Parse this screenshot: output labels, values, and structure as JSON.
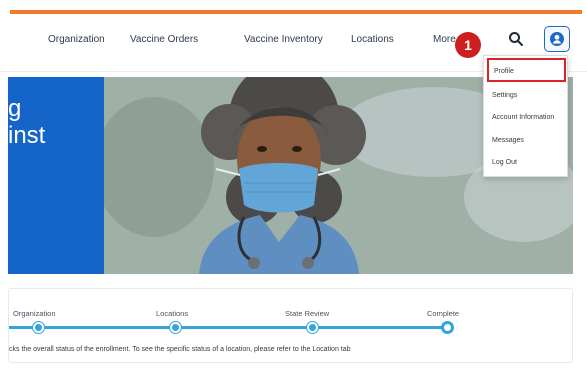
{
  "nav": {
    "items": [
      {
        "label": "Organization"
      },
      {
        "label": "Vaccine Orders"
      },
      {
        "label": "Vaccine Inventory"
      },
      {
        "label": "Locations"
      },
      {
        "label": "More"
      }
    ]
  },
  "icons": {
    "search": "search-icon",
    "user": "user-icon"
  },
  "step_marker": "1",
  "dropdown": {
    "items": [
      {
        "label": "Profile"
      },
      {
        "label": "Settings"
      },
      {
        "label": "Account Information"
      },
      {
        "label": "Messages"
      },
      {
        "label": "Log Out"
      }
    ]
  },
  "hero": {
    "title_line1": "g",
    "title_line2": "inst"
  },
  "progress": {
    "steps": [
      {
        "label": "Organization"
      },
      {
        "label": "Locations"
      },
      {
        "label": "State Review"
      },
      {
        "label": "Complete"
      }
    ],
    "info": "cks the overall status of the enrollment. To see the specific status of a location, please refer to the Location tab"
  },
  "colors": {
    "accent_orange": "#f07c2a",
    "brand_blue": "#1565c8",
    "progress_blue": "#31a4dc",
    "highlight_red": "#d8232a",
    "marker_red": "#cc1f1f"
  }
}
